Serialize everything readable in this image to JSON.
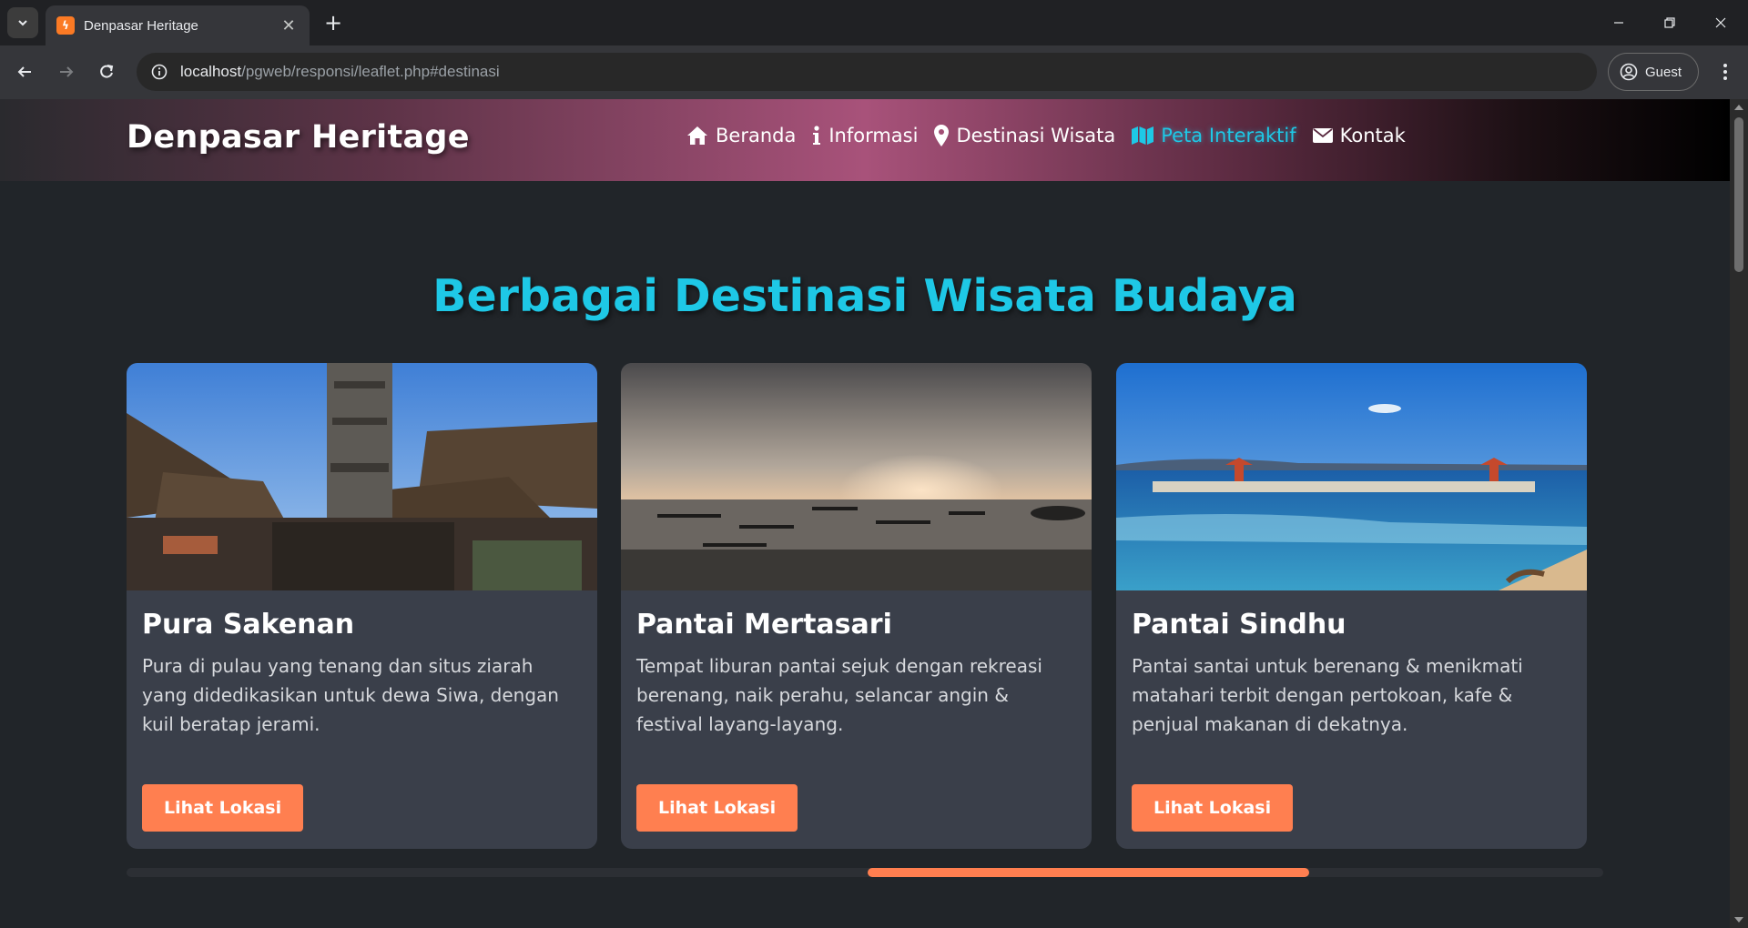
{
  "browser": {
    "tab_title": "Denpasar Heritage",
    "url_host": "localhost",
    "url_path": "/pgweb/responsi/leaflet.php#destinasi",
    "profile_label": "Guest"
  },
  "site": {
    "brand": "Denpasar Heritage",
    "nav": [
      {
        "label": "Beranda",
        "icon": "home-icon"
      },
      {
        "label": "Informasi",
        "icon": "info-icon"
      },
      {
        "label": "Destinasi Wisata",
        "icon": "map-marker-icon"
      },
      {
        "label": "Peta Interaktif",
        "icon": "map-icon",
        "active": true
      },
      {
        "label": "Kontak",
        "icon": "envelope-icon"
      }
    ],
    "accent_color": "#1ec8e6",
    "button_color": "#ff7f50"
  },
  "section": {
    "title": "Berbagai Destinasi Wisata Budaya"
  },
  "cards": [
    {
      "title": "Pura Sakenan",
      "text": "Pura di pulau yang tenang dan situs ziarah yang didedikasikan untuk dewa Siwa, dengan kuil beratap jerami.",
      "button": "Lihat Lokasi"
    },
    {
      "title": "Pantai Mertasari",
      "text": "Tempat liburan pantai sejuk dengan rekreasi berenang, naik perahu, selancar angin & festival layang-layang.",
      "button": "Lihat Lokasi"
    },
    {
      "title": "Pantai Sindhu",
      "text": "Pantai santai untuk berenang & menikmati matahari terbit dengan pertokoan, kafe & penjual makanan di dekatnya.",
      "button": "Lihat Lokasi"
    }
  ]
}
